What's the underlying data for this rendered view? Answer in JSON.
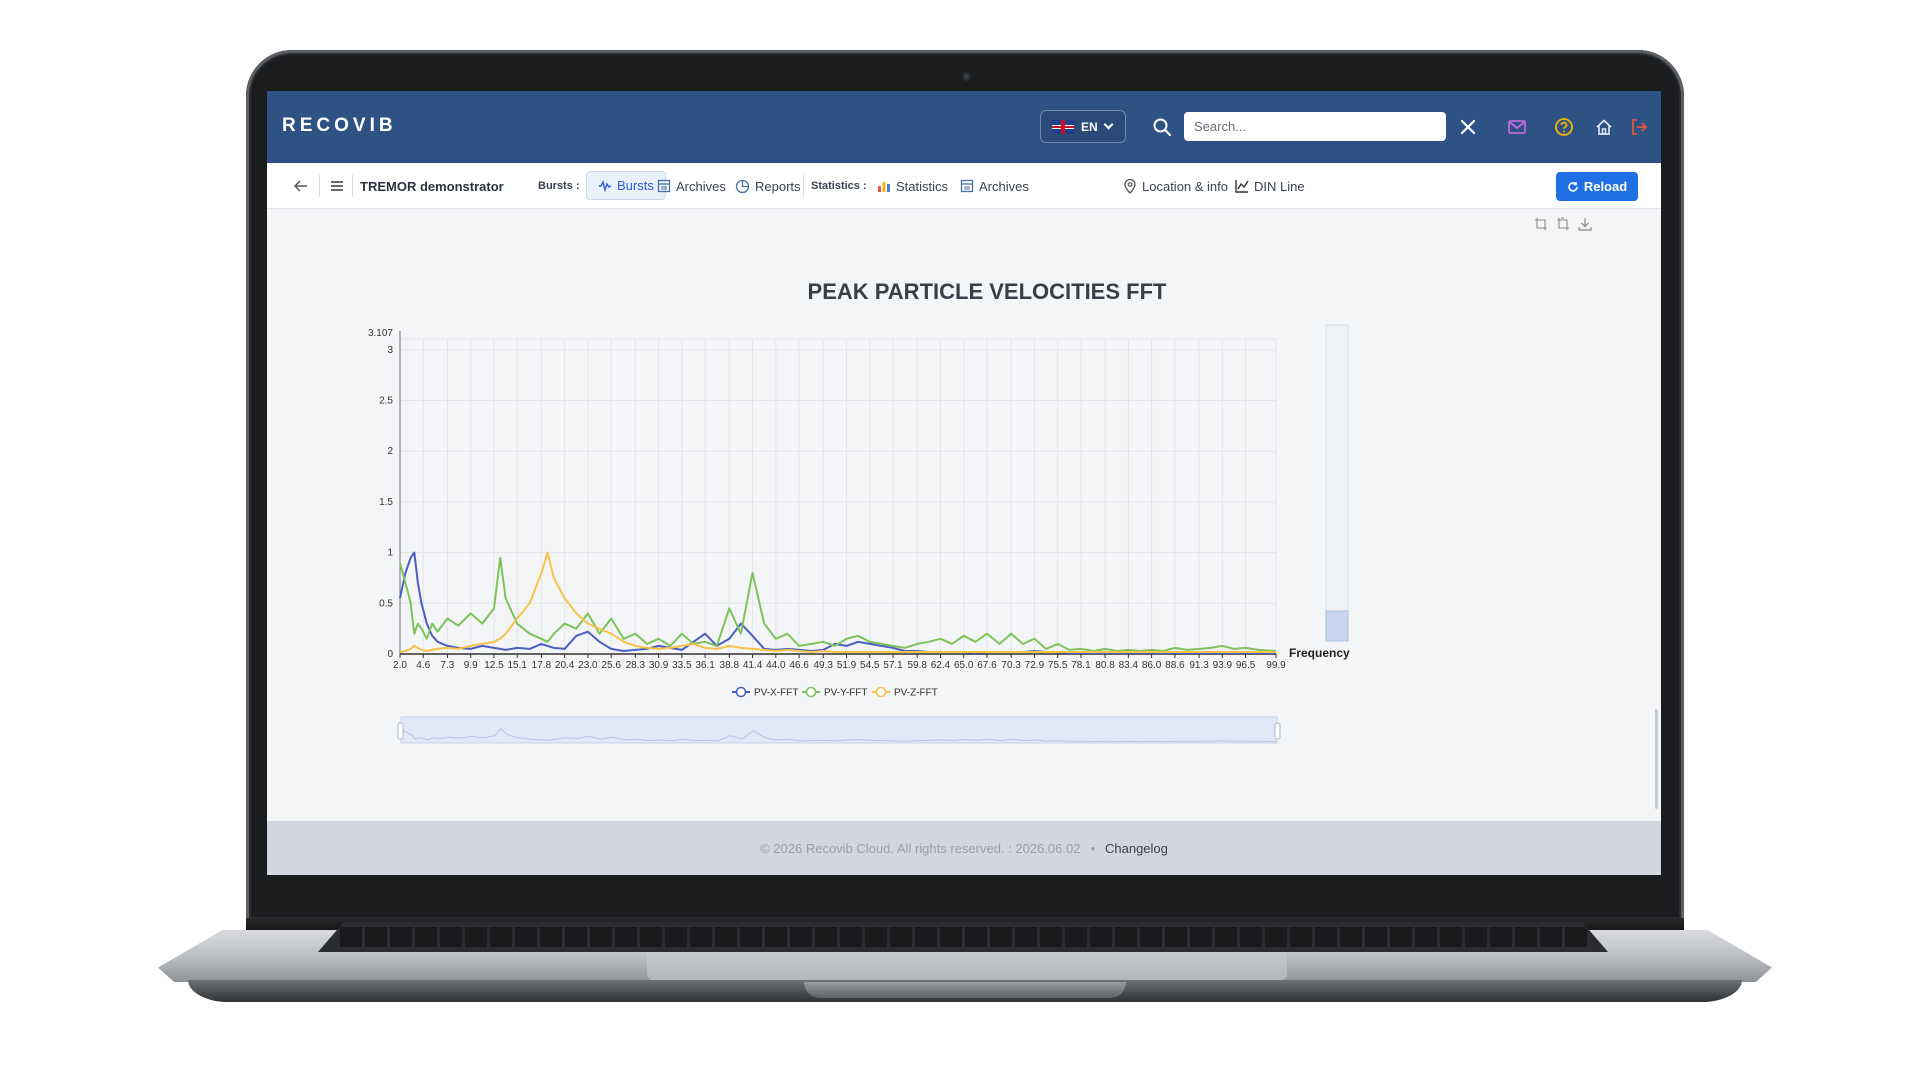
{
  "header": {
    "logo": "RECOVIB",
    "language": "EN",
    "search_placeholder": "Search..."
  },
  "toolbar": {
    "device_name": "TREMOR demonstrator",
    "bursts_label": "Bursts :",
    "bursts_tab": "Bursts",
    "archives_tab": "Archives",
    "reports_tab": "Reports",
    "statistics_label": "Statistics :",
    "statistics_tab": "Statistics",
    "statistics_archives_tab": "Archives",
    "location_link": "Location & info",
    "din_line_link": "DIN Line",
    "reload_button": "Reload"
  },
  "chart_data": {
    "type": "line",
    "title": "PEAK PARTICLE VELOCITIES FFT",
    "xlabel": "Frequency",
    "ylabel": "",
    "ylim": [
      0,
      3.107
    ],
    "yticks": [
      "3.107",
      "3",
      "2.5",
      "2",
      "1.5",
      "1",
      "0.5",
      "0"
    ],
    "xticks": [
      "2.0",
      "4.6",
      "7.3",
      "9.9",
      "12.5",
      "15.1",
      "17.8",
      "20.4",
      "23.0",
      "25.6",
      "28.3",
      "30.9",
      "33.5",
      "36.1",
      "38.8",
      "41.4",
      "44.0",
      "46.6",
      "49.3",
      "51.9",
      "54.5",
      "57.1",
      "59.8",
      "62.4",
      "65.0",
      "67.6",
      "70.3",
      "72.9",
      "75.5",
      "78.1",
      "80.8",
      "83.4",
      "86.0",
      "88.6",
      "91.3",
      "93.9",
      "96.5",
      "99.9"
    ],
    "x": [
      2.0,
      2.6,
      3.2,
      3.6,
      4.0,
      4.4,
      5.0,
      5.6,
      6.2,
      7.3,
      8.5,
      9.9,
      11.2,
      12.5,
      13.2,
      13.8,
      15.1,
      16.5,
      17.8,
      18.5,
      19.2,
      20.4,
      21.7,
      23.0,
      24.3,
      25.6,
      27.0,
      28.3,
      29.6,
      30.9,
      32.2,
      33.5,
      34.8,
      36.1,
      37.4,
      38.8,
      40.1,
      41.4,
      42.7,
      44.0,
      45.3,
      46.6,
      48.0,
      49.3,
      50.6,
      51.9,
      53.2,
      54.5,
      55.8,
      57.1,
      58.4,
      59.8,
      61.1,
      62.4,
      63.7,
      65.0,
      66.3,
      67.6,
      69.0,
      70.3,
      71.6,
      72.9,
      74.2,
      75.5,
      76.8,
      78.1,
      79.5,
      80.8,
      82.1,
      83.4,
      84.7,
      86.0,
      87.3,
      88.6,
      90.0,
      91.3,
      92.6,
      93.9,
      95.2,
      96.5,
      97.9,
      99.9
    ],
    "series": [
      {
        "name": "PV-X-FFT",
        "color": "#4a5fc1",
        "values": [
          0.55,
          0.8,
          0.95,
          1.0,
          0.7,
          0.5,
          0.3,
          0.18,
          0.12,
          0.08,
          0.06,
          0.05,
          0.08,
          0.06,
          0.05,
          0.04,
          0.06,
          0.05,
          0.1,
          0.08,
          0.06,
          0.05,
          0.18,
          0.22,
          0.12,
          0.05,
          0.03,
          0.04,
          0.05,
          0.08,
          0.06,
          0.04,
          0.12,
          0.2,
          0.08,
          0.15,
          0.3,
          0.18,
          0.05,
          0.04,
          0.05,
          0.04,
          0.03,
          0.04,
          0.1,
          0.08,
          0.12,
          0.1,
          0.08,
          0.06,
          0.03,
          0.03,
          0.02,
          0.02,
          0.02,
          0.02,
          0.01,
          0.02,
          0.02,
          0.02,
          0.02,
          0.03,
          0.02,
          0.02,
          0.01,
          0.01,
          0.01,
          0.01,
          0.01,
          0.01,
          0.01,
          0.01,
          0.01,
          0.01,
          0.01,
          0.01,
          0.01,
          0.01,
          0.01,
          0.01,
          0.01,
          0.01
        ]
      },
      {
        "name": "PV-Y-FFT",
        "color": "#7cc35a",
        "values": [
          0.9,
          0.7,
          0.5,
          0.2,
          0.3,
          0.25,
          0.15,
          0.3,
          0.22,
          0.35,
          0.28,
          0.4,
          0.3,
          0.45,
          0.95,
          0.55,
          0.3,
          0.2,
          0.15,
          0.12,
          0.2,
          0.3,
          0.25,
          0.4,
          0.2,
          0.35,
          0.15,
          0.2,
          0.1,
          0.15,
          0.08,
          0.2,
          0.1,
          0.12,
          0.08,
          0.45,
          0.2,
          0.8,
          0.3,
          0.15,
          0.2,
          0.08,
          0.1,
          0.12,
          0.08,
          0.15,
          0.18,
          0.12,
          0.1,
          0.08,
          0.06,
          0.1,
          0.12,
          0.15,
          0.1,
          0.18,
          0.12,
          0.2,
          0.1,
          0.2,
          0.1,
          0.15,
          0.05,
          0.1,
          0.04,
          0.05,
          0.03,
          0.05,
          0.03,
          0.04,
          0.03,
          0.04,
          0.03,
          0.06,
          0.04,
          0.05,
          0.06,
          0.08,
          0.05,
          0.06,
          0.04,
          0.03
        ]
      },
      {
        "name": "PV-Z-FFT",
        "color": "#f5c34a",
        "values": [
          0.02,
          0.03,
          0.05,
          0.08,
          0.06,
          0.04,
          0.03,
          0.04,
          0.05,
          0.06,
          0.05,
          0.08,
          0.1,
          0.12,
          0.15,
          0.2,
          0.35,
          0.5,
          0.8,
          1.0,
          0.75,
          0.55,
          0.4,
          0.3,
          0.25,
          0.2,
          0.12,
          0.08,
          0.06,
          0.05,
          0.06,
          0.08,
          0.1,
          0.06,
          0.05,
          0.08,
          0.06,
          0.05,
          0.04,
          0.03,
          0.04,
          0.03,
          0.02,
          0.03,
          0.02,
          0.02,
          0.02,
          0.02,
          0.02,
          0.02,
          0.02,
          0.02,
          0.02,
          0.02,
          0.02,
          0.02,
          0.02,
          0.02,
          0.02,
          0.02,
          0.02,
          0.02,
          0.02,
          0.02,
          0.02,
          0.02,
          0.02,
          0.02,
          0.02,
          0.02,
          0.02,
          0.02,
          0.02,
          0.02,
          0.02,
          0.02,
          0.02,
          0.02,
          0.02,
          0.02,
          0.02,
          0.02
        ]
      }
    ],
    "grid": true,
    "legend_position": "bottom-center"
  },
  "footer": {
    "copyright": "© 2026 Recovib Cloud. All rights reserved. : 2026.06.02",
    "bullet": "•",
    "changelog": "Changelog"
  },
  "colors": {
    "header_bg": "#2e5284",
    "accent": "#1f6fe5",
    "mail_icon": "#c06adb",
    "help_icon": "#f2b705",
    "logout_icon": "#e0563d"
  }
}
